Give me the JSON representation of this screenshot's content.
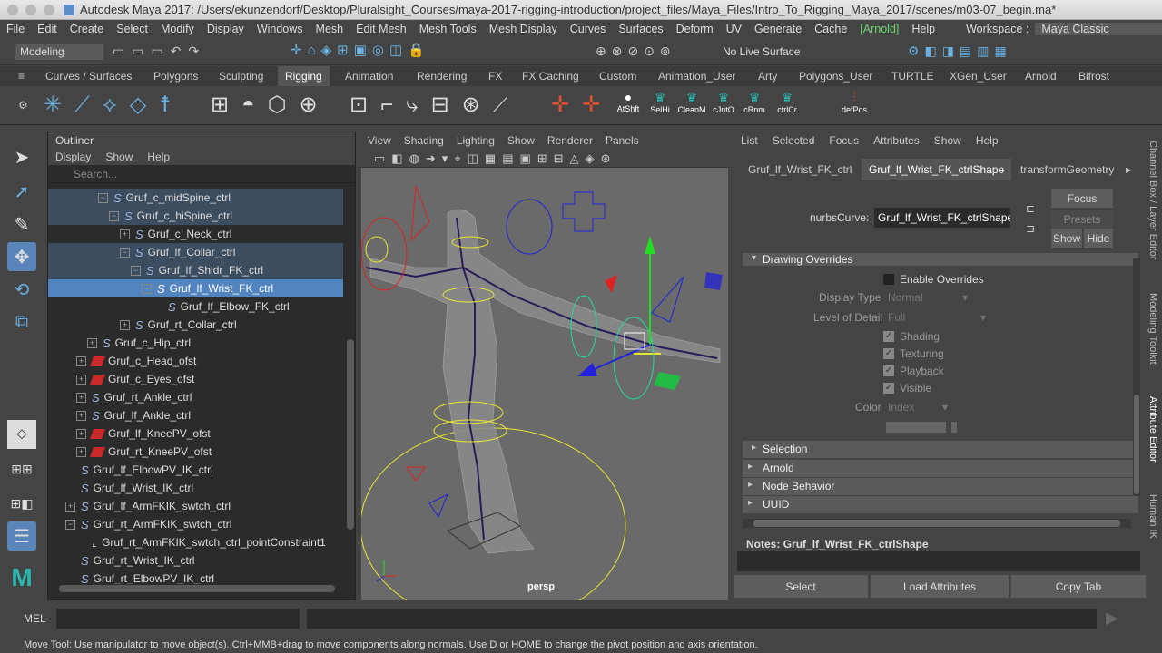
{
  "window": {
    "title": "Autodesk Maya 2017: /Users/ekunzendorf/Desktop/Pluralsight_Courses/maya-2017-rigging-introduction/project_files/Maya_Files/Intro_To_Rigging_Maya_2017/scenes/m03-07_begin.ma*"
  },
  "menubar": {
    "items": [
      "File",
      "Edit",
      "Create",
      "Select",
      "Modify",
      "Display",
      "Windows",
      "Mesh",
      "Edit Mesh",
      "Mesh Tools",
      "Mesh Display",
      "Curves",
      "Surfaces",
      "Deform",
      "UV",
      "Generate",
      "Cache",
      "[Arnold]",
      "Help"
    ],
    "workspace_label": "Workspace :",
    "workspace_value": "Maya Classic"
  },
  "statusline": {
    "mode": "Modeling",
    "live_surface": "No Live Surface"
  },
  "shelf": {
    "tabs": [
      "Curves / Surfaces",
      "Polygons",
      "Sculpting",
      "Rigging",
      "Animation",
      "Rendering",
      "FX",
      "FX Caching",
      "Custom",
      "Animation_User",
      "Arty",
      "Polygons_User",
      "TURTLE",
      "XGen_User",
      "Arnold",
      "Bifrost"
    ],
    "active_tab": "Rigging",
    "buttons": [
      "AtShft",
      "SelHi",
      "CleanM",
      "cJntO",
      "cRnm",
      "ctrlCr",
      "defPos"
    ]
  },
  "outliner": {
    "title": "Outliner",
    "menu": [
      "Display",
      "Show",
      "Help"
    ],
    "search_placeholder": "Search...",
    "rows": [
      {
        "label": "Gruf_c_midSpine_ctrl"
      },
      {
        "label": "Gruf_c_hiSpine_ctrl"
      },
      {
        "label": "Gruf_c_Neck_ctrl"
      },
      {
        "label": "Gruf_lf_Collar_ctrl"
      },
      {
        "label": "Gruf_lf_Shldr_FK_ctrl"
      },
      {
        "label": "Gruf_lf_Wrist_FK_ctrl"
      },
      {
        "label": "Gruf_lf_Elbow_FK_ctrl"
      },
      {
        "label": "Gruf_rt_Collar_ctrl"
      },
      {
        "label": "Gruf_c_Hip_ctrl"
      },
      {
        "label": "Gruf_c_Head_ofst"
      },
      {
        "label": "Gruf_c_Eyes_ofst"
      },
      {
        "label": "Gruf_rt_Ankle_ctrl"
      },
      {
        "label": "Gruf_lf_Ankle_ctrl"
      },
      {
        "label": "Gruf_lf_KneePV_ofst"
      },
      {
        "label": "Gruf_rt_KneePV_ofst"
      },
      {
        "label": "Gruf_lf_ElbowPV_IK_ctrl"
      },
      {
        "label": "Gruf_lf_Wrist_IK_ctrl"
      },
      {
        "label": "Gruf_lf_ArmFKIK_swtch_ctrl"
      },
      {
        "label": "Gruf_rt_ArmFKIK_swtch_ctrl"
      },
      {
        "label": "Gruf_rt_ArmFKIK_swtch_ctrl_pointConstraint1"
      },
      {
        "label": "Gruf_rt_Wrist_IK_ctrl"
      },
      {
        "label": "Gruf_rt_ElbowPV_IK_ctrl"
      }
    ],
    "selected": "Gruf_lf_Wrist_FK_ctrl"
  },
  "viewport": {
    "menu": [
      "View",
      "Shading",
      "Lighting",
      "Show",
      "Renderer",
      "Panels"
    ],
    "camera_label": "persp"
  },
  "attribute_editor": {
    "menu": [
      "List",
      "Selected",
      "Focus",
      "Attributes",
      "Show",
      "Help"
    ],
    "tabs": [
      "Gruf_lf_Wrist_FK_ctrl",
      "Gruf_lf_Wrist_FK_ctrlShape",
      "transformGeometry"
    ],
    "active_tab": "Gruf_lf_Wrist_FK_ctrlShape",
    "node_type_label": "nurbsCurve:",
    "node_name": "Gruf_lf_Wrist_FK_ctrlShape",
    "buttons": {
      "focus": "Focus",
      "presets": "Presets",
      "show": "Show",
      "hide": "Hide"
    },
    "drawing_overrides": {
      "title": "Drawing Overrides",
      "enable_overrides": "Enable Overrides",
      "display_type_label": "Display Type",
      "display_type_value": "Normal",
      "level_of_detail_label": "Level of Detail",
      "level_of_detail_value": "Full",
      "checks": [
        "Shading",
        "Texturing",
        "Playback",
        "Visible"
      ],
      "color_label": "Color",
      "color_value": "Index"
    },
    "sections": [
      "Selection",
      "Arnold",
      "Node Behavior",
      "UUID"
    ],
    "notes_label": "Notes:",
    "notes_node": "Gruf_lf_Wrist_FK_ctrlShape",
    "bottom_buttons": [
      "Select",
      "Load Attributes",
      "Copy Tab"
    ]
  },
  "side_tabs": [
    "Channel Box / Layer Editor",
    "Modeling Toolkit",
    "Attribute Editor",
    "Human IK"
  ],
  "commandline": {
    "label": "MEL"
  },
  "helpline": {
    "text": "Move Tool: Use manipulator to move object(s). Ctrl+MMB+drag to move components along normals. Use D or HOME to change the pivot position and axis orientation."
  }
}
